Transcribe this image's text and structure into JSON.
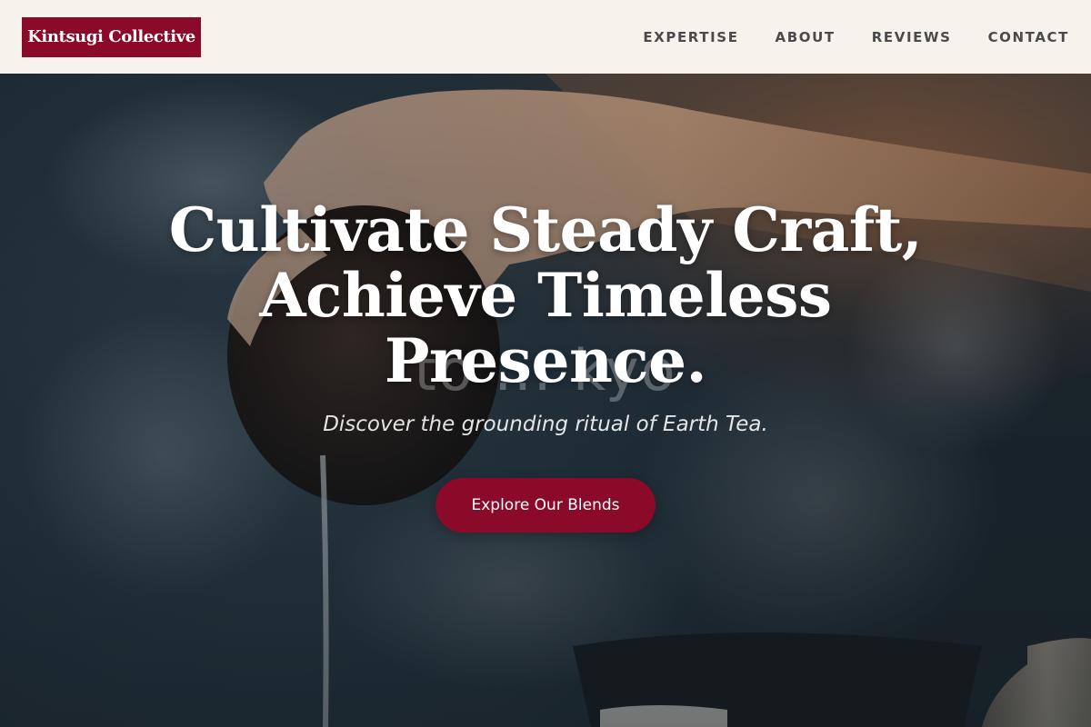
{
  "brand": {
    "name": "Kintsugi Collective",
    "accent_color": "#8b0a2a"
  },
  "nav": {
    "items": [
      {
        "label": "EXPERTISE"
      },
      {
        "label": "ABOUT"
      },
      {
        "label": "REVIEWS"
      },
      {
        "label": "CONTACT"
      }
    ]
  },
  "hero": {
    "title": "Cultivate Steady Craft, Achieve Timeless Presence.",
    "background_text": "to ... kyo",
    "subtitle": "Discover the grounding ritual of Earth Tea.",
    "cta_label": "Explore Our Blends",
    "image_description_icon": "tea-pouring-photo"
  }
}
